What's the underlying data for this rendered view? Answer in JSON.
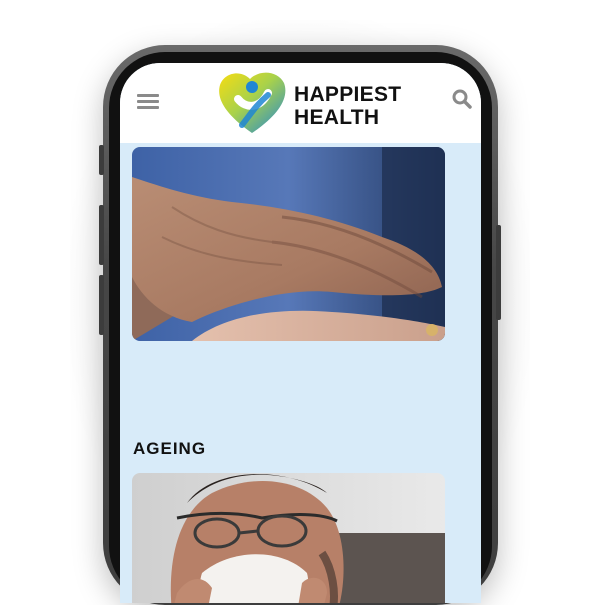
{
  "app": {
    "brand_line1": "HAPPIEST",
    "brand_line2": "HEALTH"
  },
  "header": {
    "menu_icon": "hamburger-menu-icon",
    "search_icon": "search-icon"
  },
  "cards": [
    {
      "title": "AGEING",
      "image": "elderly-hands-photo"
    },
    {
      "title": "",
      "image": "man-sneezing-photo"
    }
  ],
  "colors": {
    "screen_background": "#d8ebf9",
    "header_background": "#ffffff",
    "logo_yellow": "#f2d21a",
    "logo_blue": "#2a8fd6",
    "phone_frame": "#474747"
  }
}
